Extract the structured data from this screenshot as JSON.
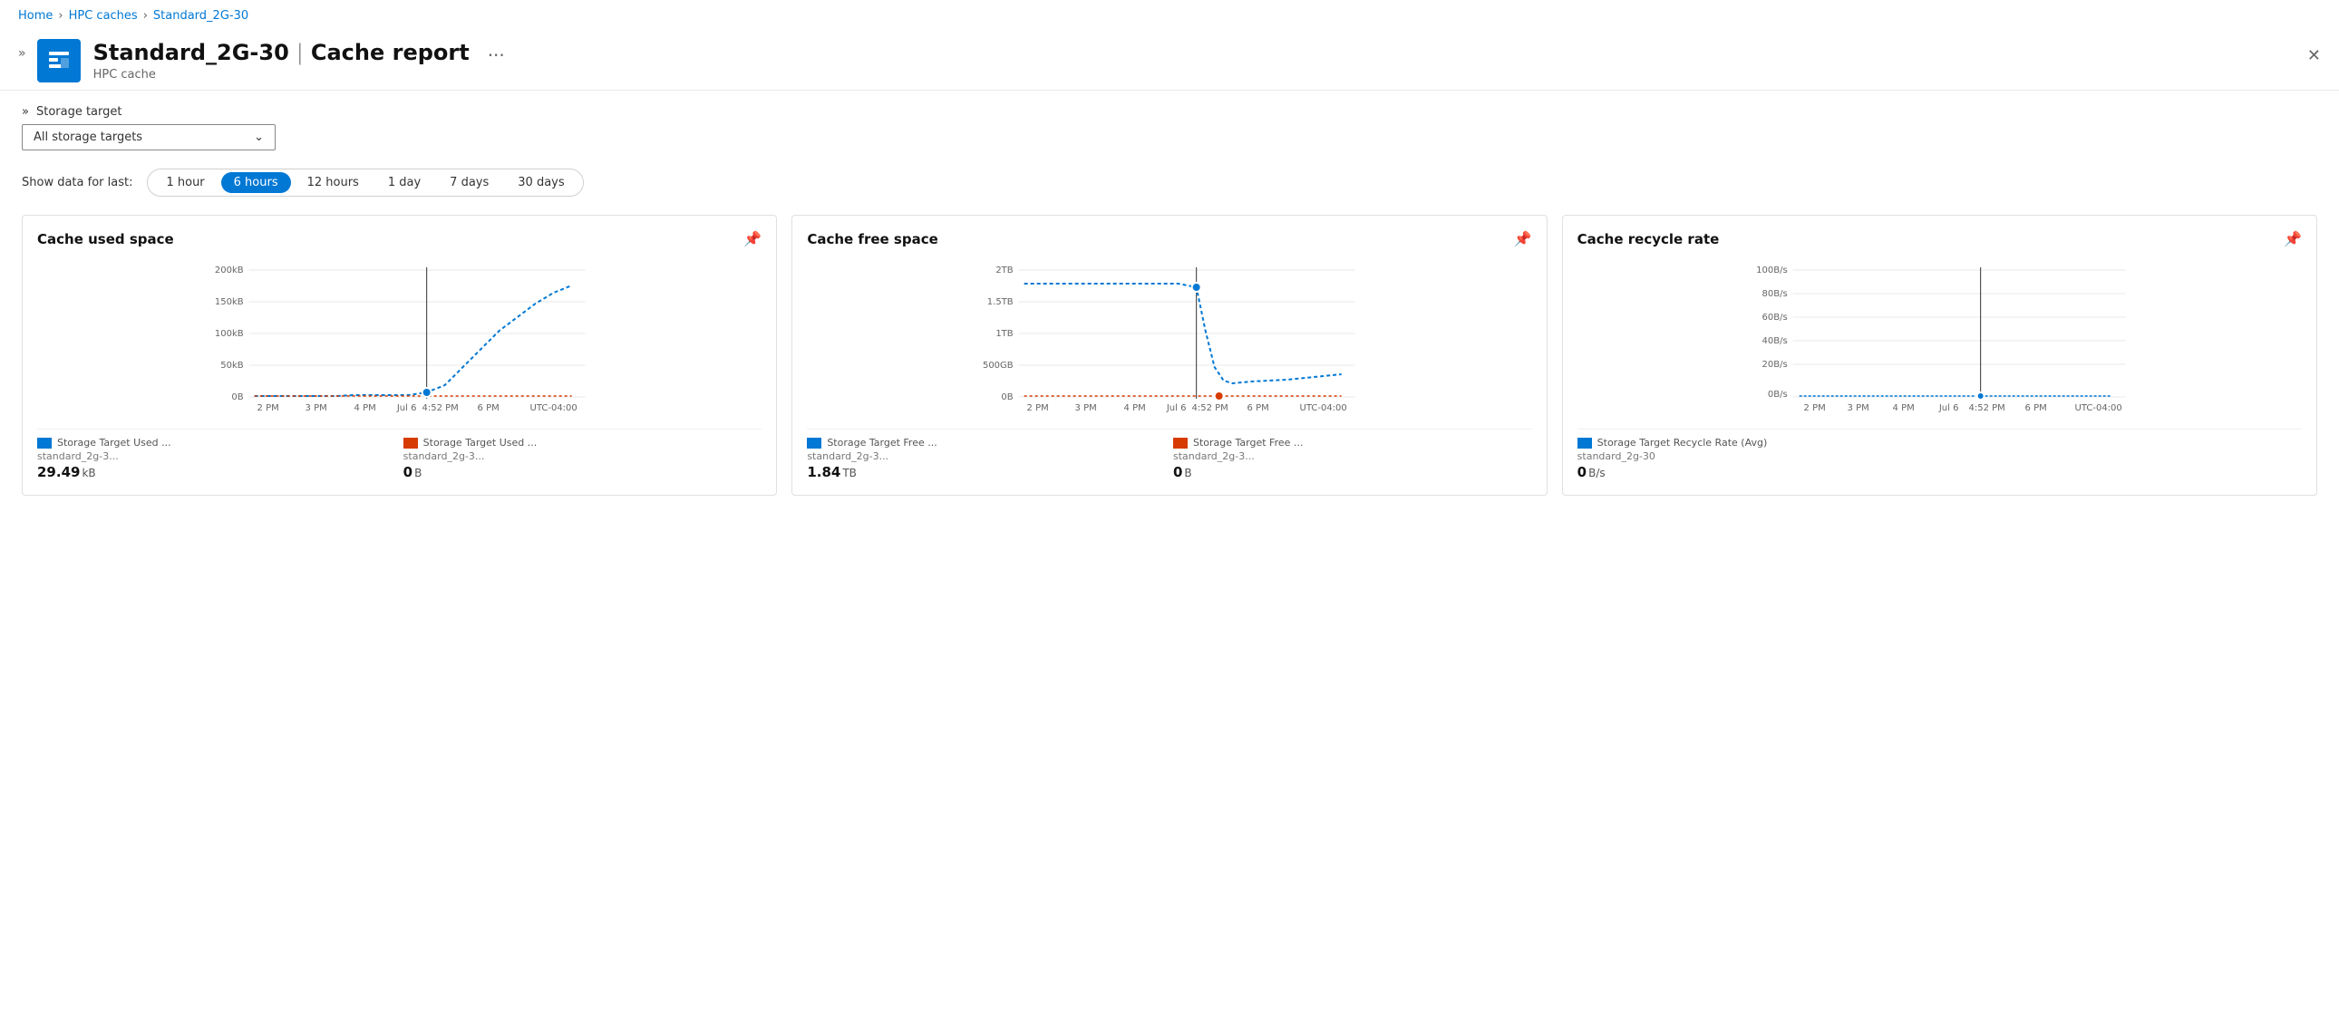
{
  "breadcrumb": {
    "items": [
      "Home",
      "HPC caches",
      "Standard_2G-30"
    ]
  },
  "header": {
    "title": "Standard_2G-30",
    "separator": "|",
    "page_name": "Cache report",
    "subtitle": "HPC cache",
    "menu_icon": "···"
  },
  "filter": {
    "label": "Storage target",
    "dropdown_value": "All storage targets",
    "expand_icon": "»"
  },
  "time_filter": {
    "label": "Show data for last:",
    "options": [
      "1 hour",
      "6 hours",
      "12 hours",
      "1 day",
      "7 days",
      "30 days"
    ],
    "active_index": 1
  },
  "charts": [
    {
      "title": "Cache used space",
      "y_labels": [
        "200kB",
        "150kB",
        "100kB",
        "50kB",
        "0B"
      ],
      "x_labels": [
        "2 PM",
        "3 PM",
        "4 PM",
        "Jul 6",
        "4:52 PM",
        "6 PM",
        "UTC-04:00"
      ],
      "legend": [
        {
          "label": "Storage Target Used ...",
          "sub": "standard_2g-3...",
          "value": "29.49",
          "unit": "kB",
          "color": "#0078d4"
        },
        {
          "label": "Storage Target Used ...",
          "sub": "standard_2g-3...",
          "value": "0",
          "unit": "B",
          "color": "#d83b01"
        }
      ]
    },
    {
      "title": "Cache free space",
      "y_labels": [
        "2TB",
        "1.5TB",
        "1TB",
        "500GB",
        "0B"
      ],
      "x_labels": [
        "2 PM",
        "3 PM",
        "4 PM",
        "Jul 6",
        "4:52 PM",
        "6 PM",
        "UTC-04:00"
      ],
      "legend": [
        {
          "label": "Storage Target Free ...",
          "sub": "standard_2g-3...",
          "value": "1.84",
          "unit": "TB",
          "color": "#0078d4"
        },
        {
          "label": "Storage Target Free ...",
          "sub": "standard_2g-3...",
          "value": "0",
          "unit": "B",
          "color": "#d83b01"
        }
      ]
    },
    {
      "title": "Cache recycle rate",
      "y_labels": [
        "100B/s",
        "80B/s",
        "60B/s",
        "40B/s",
        "20B/s",
        "0B/s"
      ],
      "x_labels": [
        "2 PM",
        "3 PM",
        "4 PM",
        "Jul 6",
        "4:52 PM",
        "6 PM",
        "UTC-04:00"
      ],
      "legend": [
        {
          "label": "Storage Target Recycle Rate (Avg)",
          "sub": "standard_2g-30",
          "value": "0",
          "unit": "B/s",
          "color": "#0078d4"
        }
      ]
    }
  ]
}
